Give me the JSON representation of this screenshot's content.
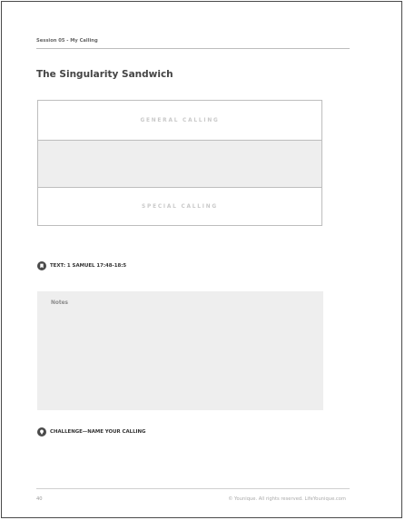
{
  "header": {
    "session_label": "Session 05 - My Calling"
  },
  "title": "The Singularity Sandwich",
  "sandwich": {
    "top_label": "GENERAL CALLING",
    "middle_label": "",
    "bottom_label": "SPECIAL CALLING"
  },
  "text_section": {
    "icon": "bookmark-icon",
    "label": "TEXT: 1 SAMUEL 17:48-18:5"
  },
  "notes": {
    "label": "Notes"
  },
  "challenge_section": {
    "icon": "lightbulb-icon",
    "label": "CHALLENGE—NAME YOUR CALLING"
  },
  "footer": {
    "page_number": "40",
    "copyright": "© Younique. All rights reserved. LifeYounique.com"
  },
  "colors": {
    "border": "#bdbdbd",
    "band_fill": "#eeeeee",
    "icon_fill": "#4a4a4a"
  }
}
